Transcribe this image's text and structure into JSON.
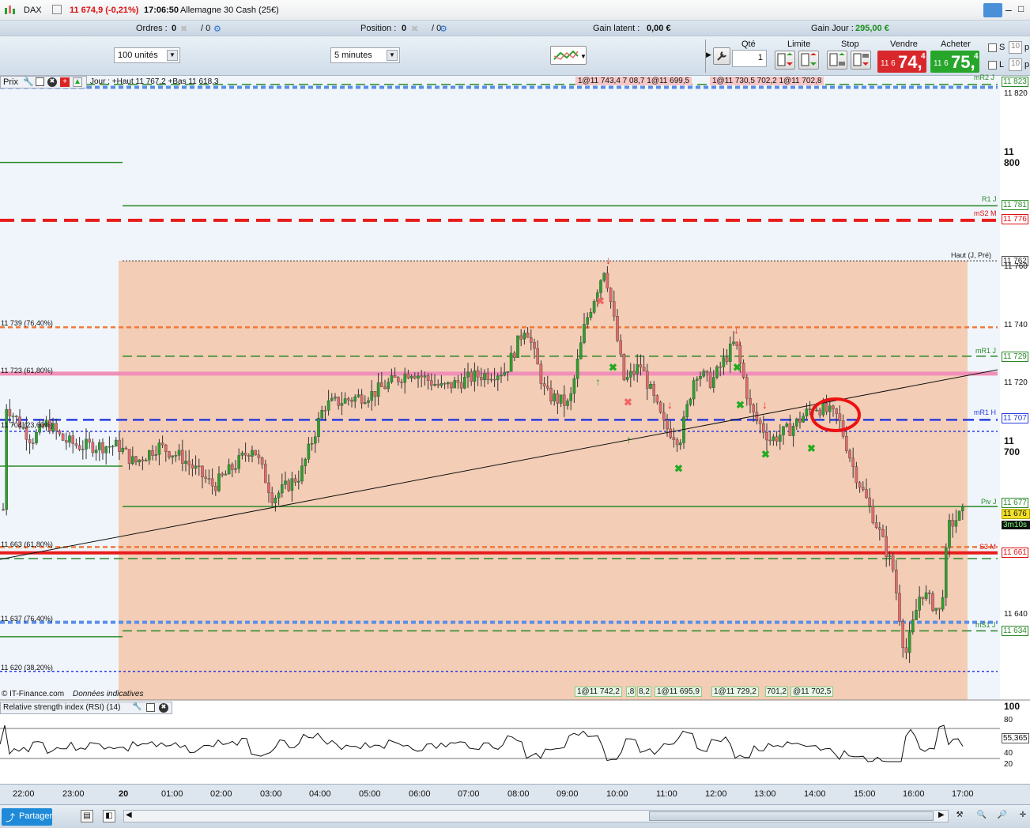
{
  "titlebar": {
    "instrument": "DAX",
    "price_change": "11 674,9 (-0,21%)",
    "time": "17:06:50",
    "description": "Allemagne 30 Cash (25€)"
  },
  "subbar": {
    "orders_label": "Ordres :",
    "orders_val1": "0",
    "orders_val2": "/ 0",
    "position_label": "Position :",
    "position_val1": "0",
    "position_val2": "/ 0",
    "latent_label": "Gain latent :",
    "latent_value": "0,00 €",
    "day_label": "Gain Jour :",
    "day_value": "295,00 €"
  },
  "toolbar": {
    "units": "100 unités",
    "timeframe": "5 minutes",
    "qty_header": "Qté",
    "qty_value": "1",
    "limit_header": "Limite",
    "stop_header": "Stop",
    "sell_header": "Vendre",
    "buy_header": "Acheter",
    "sell_prefix": "11 6",
    "sell_big": "74,",
    "sell_sup": "4",
    "buy_prefix": "11 6",
    "buy_big": "75,",
    "buy_sup": "4",
    "s_label": "S",
    "l_label": "L",
    "s_val": "10",
    "l_val": "10",
    "s_suffix": "p",
    "l_suffix": "p"
  },
  "chart": {
    "header_price": "Prix",
    "header_info": "Jour : +Haut 11 767,2 +Bas 11 618,3",
    "top_order_left": "1@11 743,4 7 08,7 1@11 699,5",
    "top_order_right": "1@11 730,5 702,2 1@11 702,8",
    "bottom_orders": [
      "1@11 742,2",
      ",8",
      "8,2",
      "1@11 695,9",
      "1@11 729,2",
      "701,2",
      "@11 702,5"
    ],
    "copyright": "© IT-Finance.com",
    "indicative": "Données indicatives",
    "fib_labels": [
      "11 739 (76,40%)",
      "11 723 (61,80%)",
      "11 704 (23,60%)",
      "11 663 (61,80%)",
      "11 637 (76,40%)",
      "11 620 (38,20%)"
    ],
    "level_labels": [
      "mR2 J",
      "R1 J",
      "mS2 M",
      "Haut (J, Pré)",
      "mR1 J",
      "mR1 H",
      "Piv J",
      "S3 M",
      "mS1 J"
    ],
    "level_values": [
      "11 823",
      "11 781",
      "11 776",
      "11 762",
      "11 729",
      "11 707",
      "11 677",
      "11 661",
      "11 634"
    ],
    "axis_ticks": [
      "11 820",
      "11 800",
      "11 760",
      "11 740",
      "11 720",
      "11 700",
      "11 640"
    ],
    "current_price": "11 676",
    "countdown": "3m10s",
    "time_ticks": [
      "22:00",
      "23:00",
      "20",
      "01:00",
      "02:00",
      "03:00",
      "04:00",
      "05:00",
      "06:00",
      "07:00",
      "08:00",
      "09:00",
      "10:00",
      "11:00",
      "12:00",
      "13:00",
      "14:00",
      "15:00",
      "16:00",
      "17:00"
    ]
  },
  "rsi": {
    "title": "Relative strength index (RSI) (14)",
    "axis": [
      "100",
      "80",
      "40",
      "20"
    ],
    "value": "55,365"
  },
  "footer": {
    "share": "Partager"
  },
  "colors": {
    "up": "#2ca02c",
    "down": "#e06b6b",
    "shade": "#f3cdb5",
    "red_level": "#e81c1c",
    "pink_level": "#f08fb8",
    "blue_level": "#2a3de0"
  }
}
